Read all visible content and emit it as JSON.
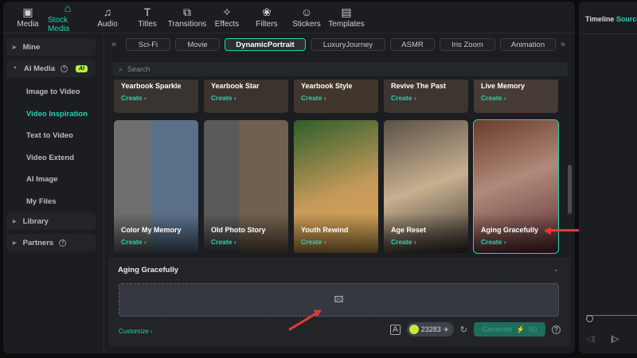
{
  "toolbar": {
    "items": [
      {
        "label": "Media",
        "icon": "media-icon",
        "glyph": "▣"
      },
      {
        "label": "Stock Media",
        "icon": "stock-media-icon",
        "glyph": "⌂"
      },
      {
        "label": "Audio",
        "icon": "audio-icon",
        "glyph": "♫"
      },
      {
        "label": "Titles",
        "icon": "titles-icon",
        "glyph": "T"
      },
      {
        "label": "Transitions",
        "icon": "transitions-icon",
        "glyph": "⧉"
      },
      {
        "label": "Effects",
        "icon": "effects-icon",
        "glyph": "✧"
      },
      {
        "label": "Filters",
        "icon": "filters-icon",
        "glyph": "❀"
      },
      {
        "label": "Stickers",
        "icon": "stickers-icon",
        "glyph": "☺"
      },
      {
        "label": "Templates",
        "icon": "templates-icon",
        "glyph": "▤"
      }
    ]
  },
  "sidebar": {
    "mine": "Mine",
    "ai_media": "AI Media",
    "ai_badge": "AI",
    "items": [
      "Image to Video",
      "Video Inspiration",
      "Text to Video",
      "Video Extend",
      "AI Image",
      "My Files"
    ],
    "library": "Library",
    "partners": "Partners"
  },
  "tags": [
    "Sci-Fi",
    "Movie",
    "DynamicPortrait",
    "LuxuryJourney",
    "ASMR",
    "Iris Zoom",
    "Animation"
  ],
  "search": {
    "placeholder": "Search"
  },
  "cards_top": [
    {
      "name": "Yearbook Sparkle",
      "cta": "Create"
    },
    {
      "name": "Yearbook Star",
      "cta": "Create"
    },
    {
      "name": "Yearbook Style",
      "cta": "Create"
    },
    {
      "name": "Revive The Past",
      "cta": "Create"
    },
    {
      "name": "Live Memory",
      "cta": "Create"
    }
  ],
  "cards": [
    {
      "name": "Color My Memory",
      "cta": "Create"
    },
    {
      "name": "Old Photo Story",
      "cta": "Create"
    },
    {
      "name": "Youth Rewind",
      "cta": "Create"
    },
    {
      "name": "Age Reset",
      "cta": "Create"
    },
    {
      "name": "Aging Gracefully",
      "cta": "Create"
    }
  ],
  "panel": {
    "title": "Aging Gracefully",
    "customize": "Customize",
    "credits": "23283",
    "generate": "Generate",
    "cost": "60"
  },
  "right": {
    "tab_timeline": "Timeline",
    "tab_source": "Source"
  },
  "colors": {
    "accent": "#27d3b0",
    "arrow": "#e03a3a"
  }
}
